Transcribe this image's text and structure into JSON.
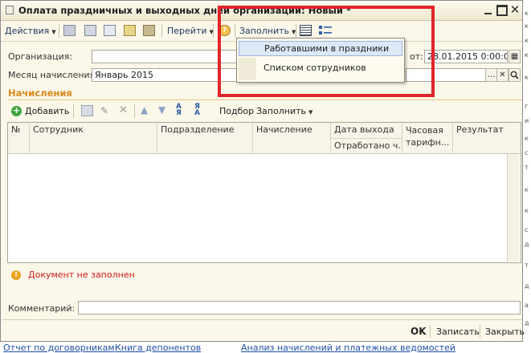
{
  "window": {
    "title": "Оплата праздничных и выходных дней организаций: Новый *"
  },
  "toolbar": {
    "actions_label": "Действия",
    "goto_label": "Перейти",
    "fill_label": "Заполнить"
  },
  "form": {
    "org_label": "Организация:",
    "org_value": "",
    "date_label": "от:",
    "date_value": "28.01.2015  0:00:00",
    "month_label": "Месяц начисления:",
    "month_value": "Январь 2015",
    "comment_label": "Комментарий:",
    "comment_value": ""
  },
  "dropdown": {
    "items": [
      "Работавшими в праздники",
      "Списком сотрудников"
    ]
  },
  "section": {
    "title": "Начисления",
    "add_label": "Добавить",
    "podbor_label": "Подбор",
    "fill_label": "Заполнить"
  },
  "table": {
    "columns": [
      "№",
      "Сотрудник",
      "Подразделение",
      "Начисление",
      "Дата выхода",
      "Отработано ч...",
      "Часовая тарифн...",
      "Результат"
    ]
  },
  "status": {
    "text": "Документ не заполнен"
  },
  "footer": {
    "ok_label": "OK",
    "save_label": "Записать",
    "close_label": "Закрыть"
  },
  "background_links": [
    "Отчет по договорникам",
    "Книга депонентов",
    "Анализ начислений и платежных ведомостей"
  ],
  "colors": {
    "highlight": "#e0252a",
    "section_title": "#d98b1b",
    "error_text": "#d11b1b",
    "link": "#1f4fa6"
  }
}
